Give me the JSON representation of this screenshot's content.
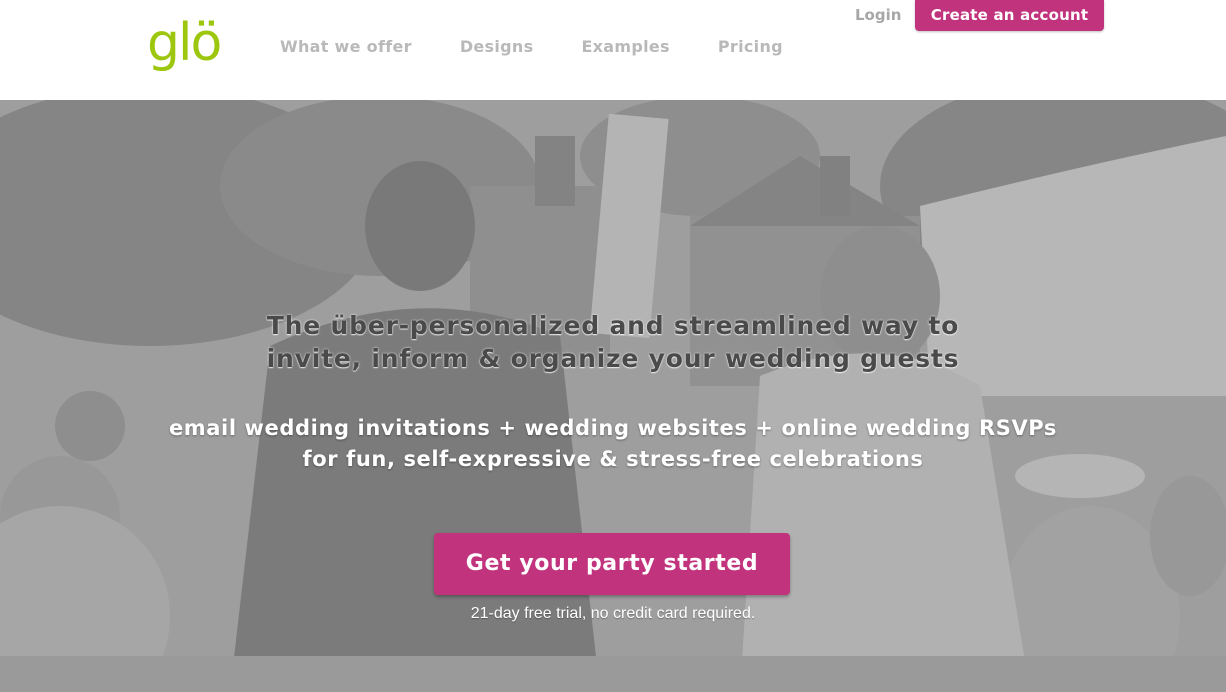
{
  "header": {
    "logo_text": "glö",
    "nav": [
      {
        "label": "What we offer"
      },
      {
        "label": "Designs"
      },
      {
        "label": "Examples"
      },
      {
        "label": "Pricing"
      }
    ],
    "login_label": "Login",
    "create_account_label": "Create an account"
  },
  "hero": {
    "headline_line1": "The über-personalized and streamlined way to",
    "headline_line2": "invite, inform & organize your wedding guests",
    "sub_line1": "email wedding invitations + wedding websites + online wedding RSVPs",
    "sub_line2": "for fun, self-expressive & stress-free celebrations",
    "cta_label": "Get your party started",
    "trial_note": "21-day free trial, no credit card required."
  },
  "colors": {
    "brand_green": "#9cc70e",
    "brand_pink": "#c1337c",
    "nav_gray": "#b9b9b9"
  }
}
